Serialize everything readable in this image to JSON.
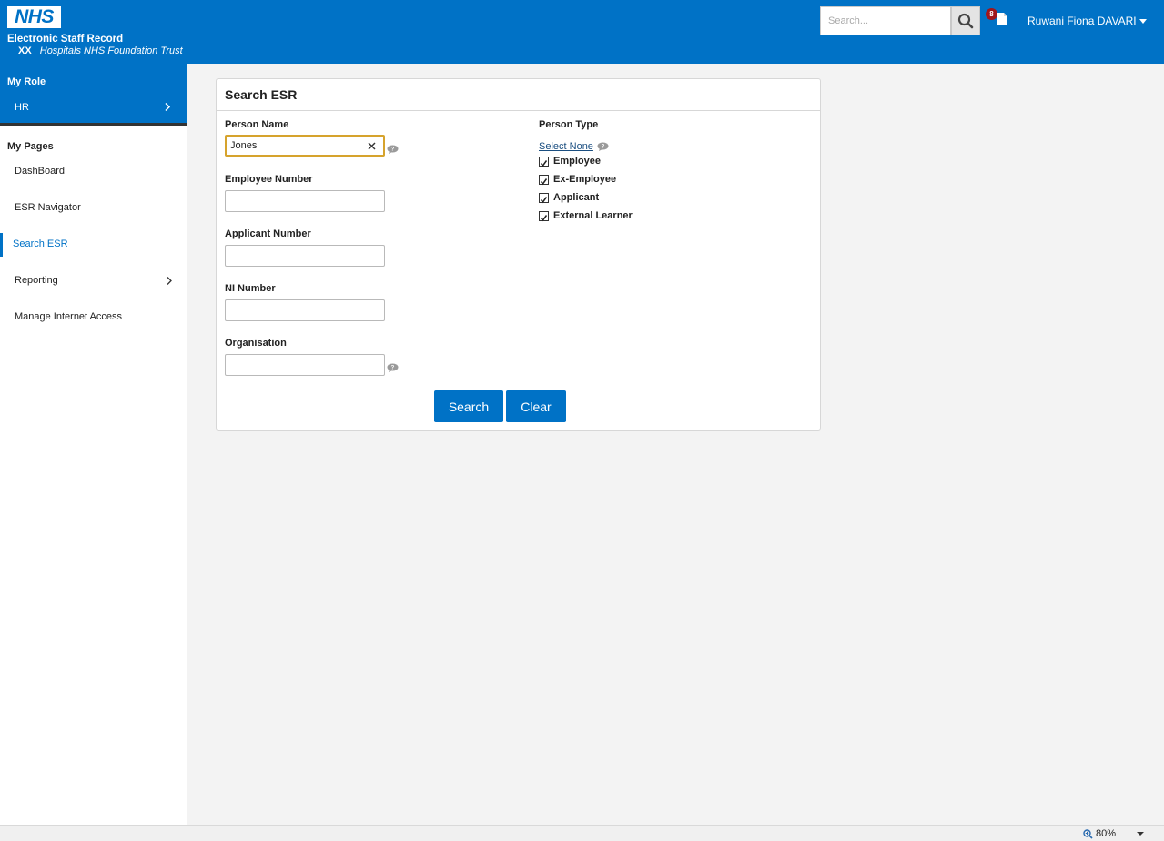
{
  "header": {
    "logo": "NHS",
    "app_title": "Electronic Staff Record",
    "org_code": "XX",
    "org_name": "Hospitals NHS Foundation Trust",
    "search_placeholder": "Search...",
    "notification_count": "8",
    "user_name": "Ruwani Fiona DAVARI",
    "brand_color": "#0072c6"
  },
  "sidebar": {
    "role_heading": "My Role",
    "role_item": "HR",
    "pages_heading": "My Pages",
    "items": [
      {
        "label": "DashBoard"
      },
      {
        "label": "ESR Navigator"
      },
      {
        "label": "Search ESR",
        "active": true
      },
      {
        "label": "Reporting",
        "has_submenu": true
      },
      {
        "label": "Manage Internet Access"
      }
    ]
  },
  "form": {
    "title": "Search ESR",
    "person_name_label": "Person Name",
    "person_name_value": "Jones",
    "employee_number_label": "Employee Number",
    "employee_number_value": "",
    "applicant_number_label": "Applicant Number",
    "applicant_number_value": "",
    "ni_number_label": "NI Number",
    "ni_number_value": "",
    "organisation_label": "Organisation",
    "organisation_value": "",
    "person_type_label": "Person Type",
    "select_none_label": "Select None",
    "person_types": [
      {
        "label": "Employee",
        "checked": true
      },
      {
        "label": "Ex-Employee",
        "checked": true
      },
      {
        "label": "Applicant",
        "checked": true
      },
      {
        "label": "External Learner",
        "checked": true
      }
    ],
    "search_button": "Search",
    "clear_button": "Clear"
  },
  "statusbar": {
    "zoom": "80%"
  },
  "icons": {
    "search": "magnifier-icon",
    "notification": "document-icon",
    "help": "speech-bubble-help-icon",
    "clear": "close-icon",
    "chevron": "chevron-right-icon",
    "check": "checkmark-icon"
  }
}
